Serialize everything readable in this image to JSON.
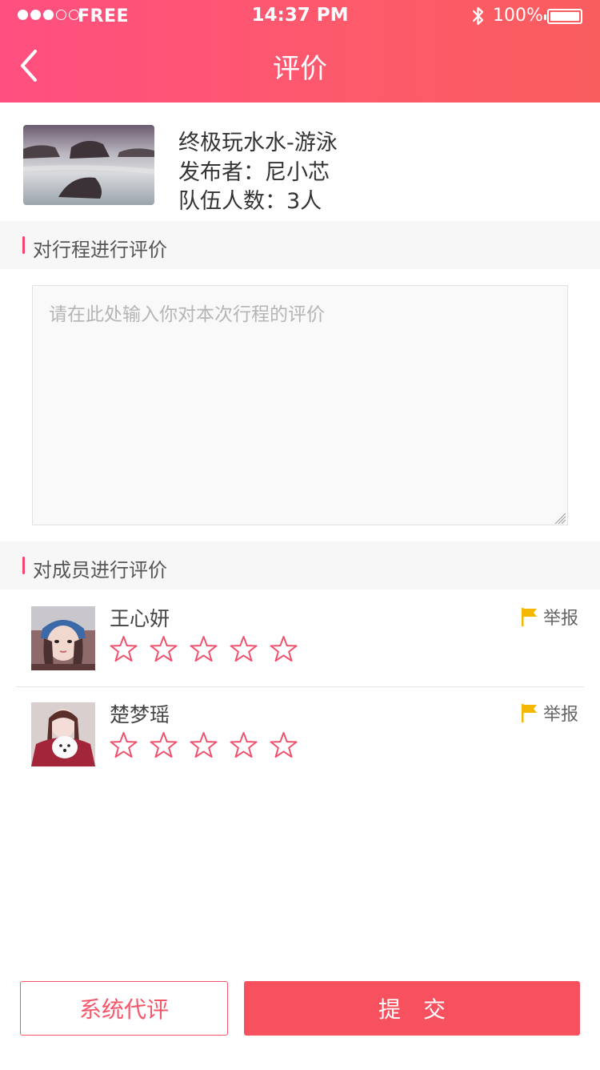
{
  "status_bar": {
    "carrier": "FREE",
    "time": "14:37 PM",
    "battery": "100%",
    "signal_strength": 3,
    "signal_max": 5,
    "icons": [
      "signal-icon",
      "bluetooth-icon",
      "battery-icon"
    ]
  },
  "nav": {
    "title": "评价",
    "back_icon": "chevron-left-icon"
  },
  "trip": {
    "name": "终极玩水水-游泳",
    "publisher": "发布者：尼小芯",
    "team_size": "队伍人数：3人"
  },
  "trip_section": {
    "title": "对行程进行评价"
  },
  "comment": {
    "value": "",
    "placeholder": "请在此处输入你对本次行程的评价"
  },
  "members_section": {
    "title": "对成员进行评价"
  },
  "members": [
    {
      "name": "王心妍",
      "rating": 0,
      "max_rating": 5,
      "report_label": "举报"
    },
    {
      "name": "楚梦瑶",
      "rating": 0,
      "max_rating": 5,
      "report_label": "举报"
    }
  ],
  "actions": {
    "system_rate": "系统代评",
    "submit": "提　交"
  },
  "colors": {
    "header_start": "#ff4f80",
    "header_end": "#fa5d5e",
    "accent": "#f7515f",
    "star": "#f04f6b",
    "flag": "#f5b800"
  }
}
